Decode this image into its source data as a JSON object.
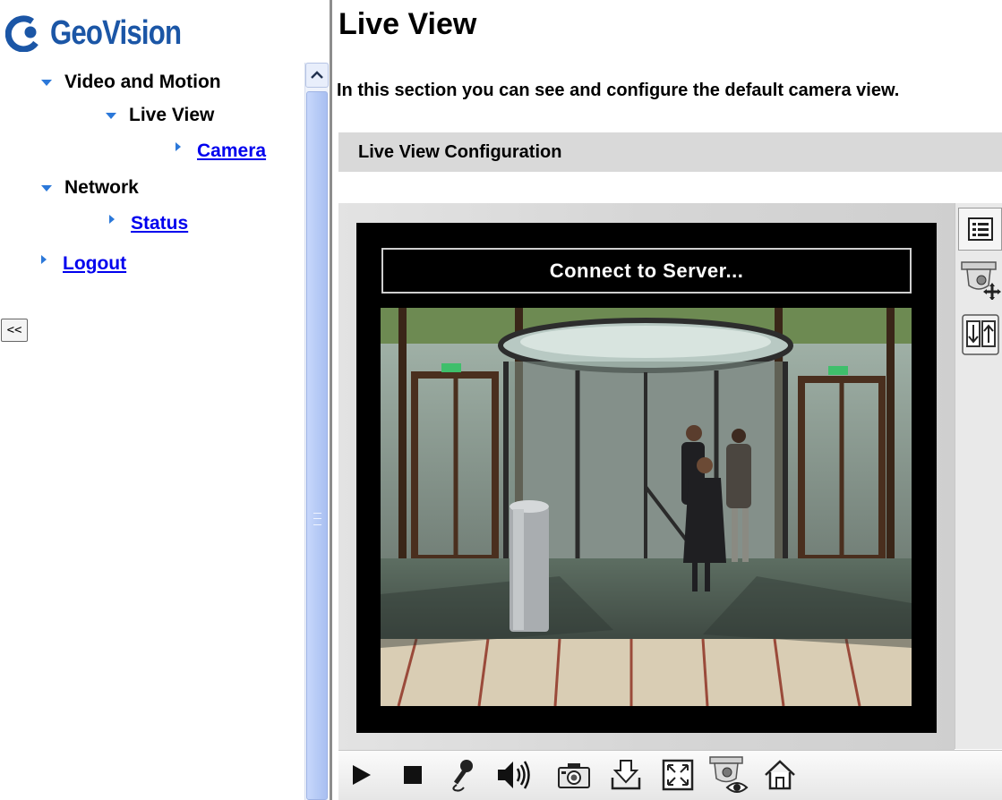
{
  "brand": {
    "logo_text": "GeoVision"
  },
  "nav": {
    "video_and_motion": "Video and Motion",
    "live_view": "Live View",
    "camera": "Camera",
    "network": "Network",
    "status": "Status",
    "logout": "Logout",
    "collapse_label": "<<"
  },
  "page": {
    "title": "Live View",
    "intro": "In this section you can see and configure the default camera view.",
    "section_title": "Live View Configuration"
  },
  "viewer": {
    "status_text": "Connect to Server..."
  },
  "icons": {
    "side_panel": [
      "settings-list-icon",
      "ptz-camera-icon",
      "io-control-icon"
    ],
    "toolbar": [
      "play-icon",
      "stop-icon",
      "microphone-icon",
      "speaker-icon",
      "snapshot-camera-icon",
      "download-icon",
      "fullscreen-icon",
      "camera-view-icon",
      "home-icon"
    ]
  },
  "colors": {
    "brand_blue": "#1b56a6",
    "nav_arrow": "#2b78d9",
    "link": "#0000ee"
  }
}
